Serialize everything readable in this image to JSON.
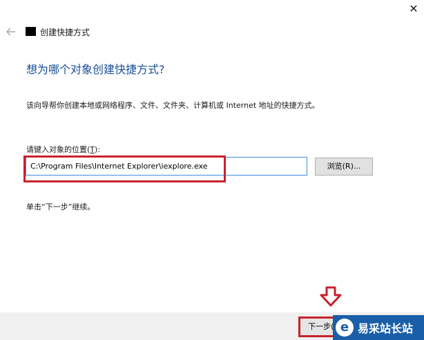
{
  "window": {
    "close_glyph": "✕"
  },
  "header": {
    "back_icon": "back-arrow-icon",
    "app_icon": "shortcut-icon",
    "title": "创建快捷方式"
  },
  "main": {
    "heading": "想为哪个对象创建快捷方式?",
    "description": "该向导帮你创建本地或网络程序、文件、文件夹、计算机或 Internet 地址的快捷方式。",
    "location_label_prefix": "请键入对象的位置(",
    "location_label_key": "T",
    "location_label_suffix": "):",
    "location_value": "C:\\Program Files\\Internet Explorer\\iexplore.exe",
    "browse_button": "浏览(R)...",
    "hint": "单击“下一步”继续。"
  },
  "footer": {
    "next_button": "下一步(N)"
  },
  "watermark": {
    "logo_glyph": "e",
    "text": "易采站长站"
  },
  "colors": {
    "heading": "#1a4f96",
    "highlight": "#c8202b",
    "input_border": "#3c8ddc"
  }
}
